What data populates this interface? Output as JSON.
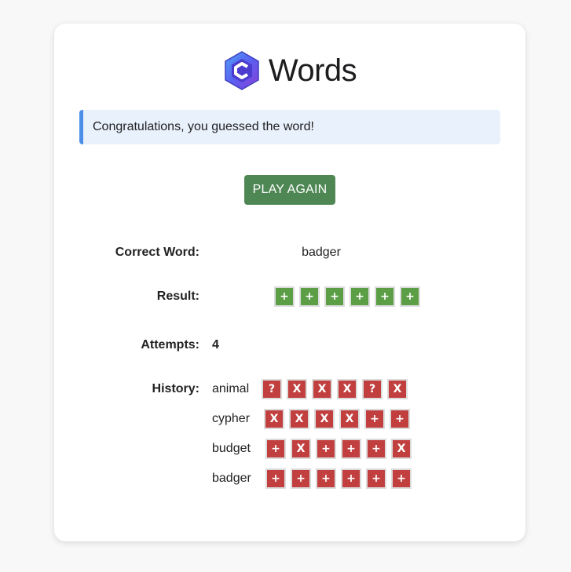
{
  "app": {
    "title": "Words"
  },
  "alert": {
    "message": "Congratulations, you guessed the word!"
  },
  "play_again": {
    "label": "PLAY AGAIN"
  },
  "summary": {
    "correct_word_label": "Correct Word:",
    "correct_word": "badger",
    "result_label": "Result:",
    "result_tiles": [
      "+",
      "+",
      "+",
      "+",
      "+",
      "+"
    ],
    "attempts_label": "Attempts:",
    "attempts": "4",
    "history_label": "History:"
  },
  "history": [
    {
      "word": "animal",
      "tiles": [
        "?",
        "X",
        "X",
        "X",
        "?",
        "X"
      ]
    },
    {
      "word": "cypher",
      "tiles": [
        "X",
        "X",
        "X",
        "X",
        "+",
        "+"
      ]
    },
    {
      "word": "budget",
      "tiles": [
        "+",
        "X",
        "+",
        "+",
        "+",
        "X"
      ]
    },
    {
      "word": "badger",
      "tiles": [
        "+",
        "+",
        "+",
        "+",
        "+",
        "+"
      ]
    }
  ],
  "colors": {
    "green_tile": "#5b9e46",
    "red_tile": "#c1403f",
    "button": "#4e8754",
    "alert_bg": "#e9f1fd",
    "alert_border": "#4d8fe8"
  },
  "icons": {
    "logo": "hexagon-logo-icon"
  }
}
